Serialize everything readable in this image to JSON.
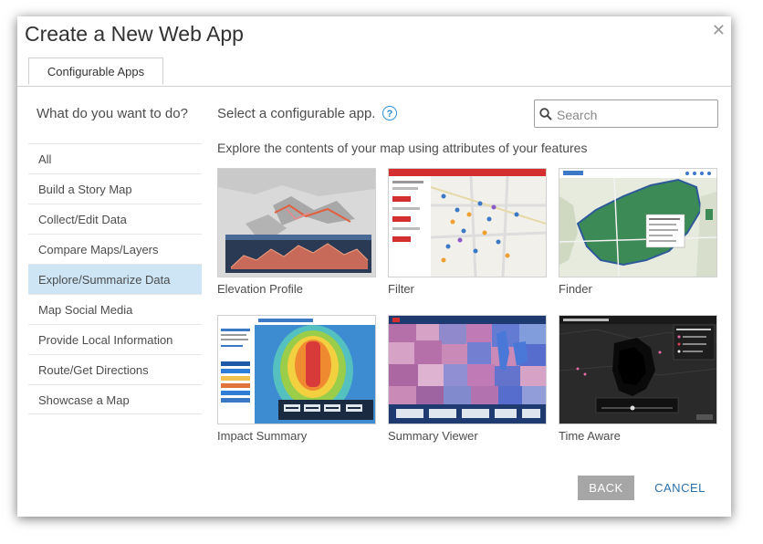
{
  "dialog": {
    "title": "Create a New Web App",
    "close_label": "✕",
    "tab_label": "Configurable Apps"
  },
  "sidebar": {
    "question": "What do you want to do?",
    "items": [
      {
        "label": "All"
      },
      {
        "label": "Build a Story Map"
      },
      {
        "label": "Collect/Edit Data"
      },
      {
        "label": "Compare Maps/Layers"
      },
      {
        "label": "Explore/Summarize Data",
        "selected": true
      },
      {
        "label": "Map Social Media"
      },
      {
        "label": "Provide Local Information"
      },
      {
        "label": "Route/Get Directions"
      },
      {
        "label": "Showcase a Map"
      }
    ]
  },
  "main": {
    "select_label": "Select a configurable app.",
    "help_icon": "?",
    "search_placeholder": "Search",
    "description": "Explore the contents of your map using attributes of your features",
    "apps": [
      {
        "label": "Elevation Profile",
        "icon": "elevation-profile-thumbnail"
      },
      {
        "label": "Filter",
        "icon": "filter-thumbnail"
      },
      {
        "label": "Finder",
        "icon": "finder-thumbnail"
      },
      {
        "label": "Impact Summary",
        "icon": "impact-summary-thumbnail"
      },
      {
        "label": "Summary Viewer",
        "icon": "summary-viewer-thumbnail"
      },
      {
        "label": "Time Aware",
        "icon": "time-aware-thumbnail"
      }
    ]
  },
  "footer": {
    "back_label": "BACK",
    "cancel_label": "CANCEL"
  },
  "colors": {
    "accent": "#2b8fd0",
    "selected_bg": "#cde5f5",
    "back_button": "#a6a6a6",
    "cancel_text": "#2b6fa8"
  }
}
